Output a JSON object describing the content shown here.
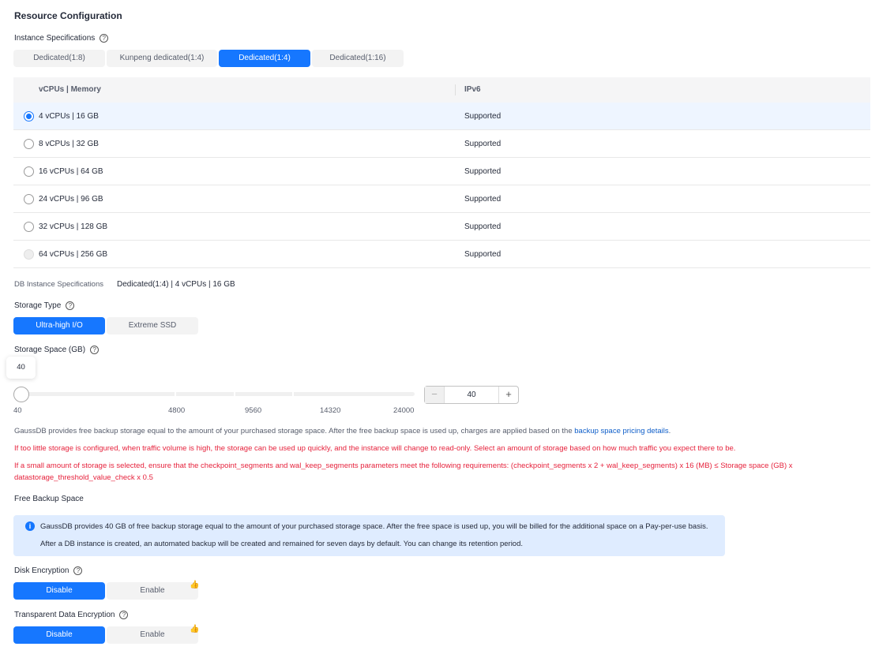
{
  "title": "Resource Configuration",
  "instance_spec": {
    "label": "Instance Specifications",
    "tabs": [
      "Dedicated(1:8)",
      "Kunpeng dedicated(1:4)",
      "Dedicated(1:4)",
      "Dedicated(1:16)"
    ],
    "active": 2
  },
  "table": {
    "headers": [
      "vCPUs | Memory",
      "IPv6"
    ],
    "rows": [
      {
        "spec": "4 vCPUs | 16 GB",
        "ipv6": "Supported"
      },
      {
        "spec": "8 vCPUs | 32 GB",
        "ipv6": "Supported"
      },
      {
        "spec": "16 vCPUs | 64 GB",
        "ipv6": "Supported"
      },
      {
        "spec": "24 vCPUs | 96 GB",
        "ipv6": "Supported"
      },
      {
        "spec": "32 vCPUs | 128 GB",
        "ipv6": "Supported"
      },
      {
        "spec": "64 vCPUs | 256 GB",
        "ipv6": "Supported"
      }
    ]
  },
  "db_spec": {
    "label": "DB Instance Specifications",
    "value": "Dedicated(1:4) | 4 vCPUs | 16 GB"
  },
  "storage_type": {
    "label": "Storage Type",
    "options": [
      "Ultra-high I/O",
      "Extreme SSD"
    ]
  },
  "storage_space": {
    "label": "Storage Space (GB)",
    "tooltip": "40",
    "value": "40",
    "ticks": [
      "40",
      "4800",
      "9560",
      "14320",
      "24000"
    ],
    "min": 40,
    "max": 24000
  },
  "notes": {
    "backup_prefix": "GaussDB provides free backup storage equal to the amount of your purchased storage space. After the free backup space is used up, charges are applied based on the ",
    "backup_link": "backup space pricing details",
    "backup_suffix": ".",
    "warn1": "If too little storage is configured, when traffic volume is high, the storage can be used up quickly, and the instance will change to read-only. Select an amount of storage based on how much traffic you expect there to be.",
    "warn2a": "If a small amount of storage is selected, ensure that the checkpoint_segments and wal_keep_segments parameters meet the following requirements: (checkpoint_segments x 2 + wal_keep_segments) x 16 (MB) ≤ Storage space (GB) x",
    "warn2b": "datastorage_threshold_value_check x 0.5"
  },
  "free_backup": {
    "label": "Free Backup Space",
    "line1": "GaussDB provides 40 GB of free backup storage equal to the amount of your purchased storage space. After the free space is used up, you will be billed for the additional space on a Pay-per-use basis.",
    "line2": "After a DB instance is created, an automated backup will be created and remained for seven days by default. You can change its retention period."
  },
  "disk_encryption": {
    "label": "Disk Encryption",
    "options": [
      "Disable",
      "Enable"
    ]
  },
  "tde": {
    "label": "Transparent Data Encryption",
    "options": [
      "Disable",
      "Enable"
    ]
  },
  "colors": {
    "accent": "#1677ff",
    "warning": "#e6223c"
  }
}
